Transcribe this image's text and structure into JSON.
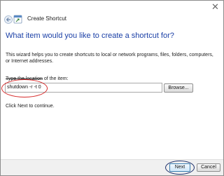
{
  "window": {
    "title": "Create Shortcut",
    "close_glyph": "✕"
  },
  "wizard": {
    "heading": "What item would you like to create a shortcut for?",
    "description": "This wizard helps you to create shortcuts to local or network programs, files, folders, computers, or Internet addresses.",
    "location_label_struck": "Type the location",
    "location_label_rest": " of the item:",
    "location_value": "shutdown -r -t 0",
    "browse_label": "Browse...",
    "hint": "Click Next to continue."
  },
  "footer": {
    "next_label": "Next",
    "cancel_label": "Cancel"
  },
  "annotations": {
    "input_oval_color": "#d62a2a",
    "next_oval_color": "#1d2f6b"
  },
  "colors": {
    "heading": "#1a3fa6",
    "footer_bg": "#f0f0f0"
  },
  "icons": [
    "close-icon",
    "back-arrow-icon",
    "shortcut-app-icon"
  ]
}
